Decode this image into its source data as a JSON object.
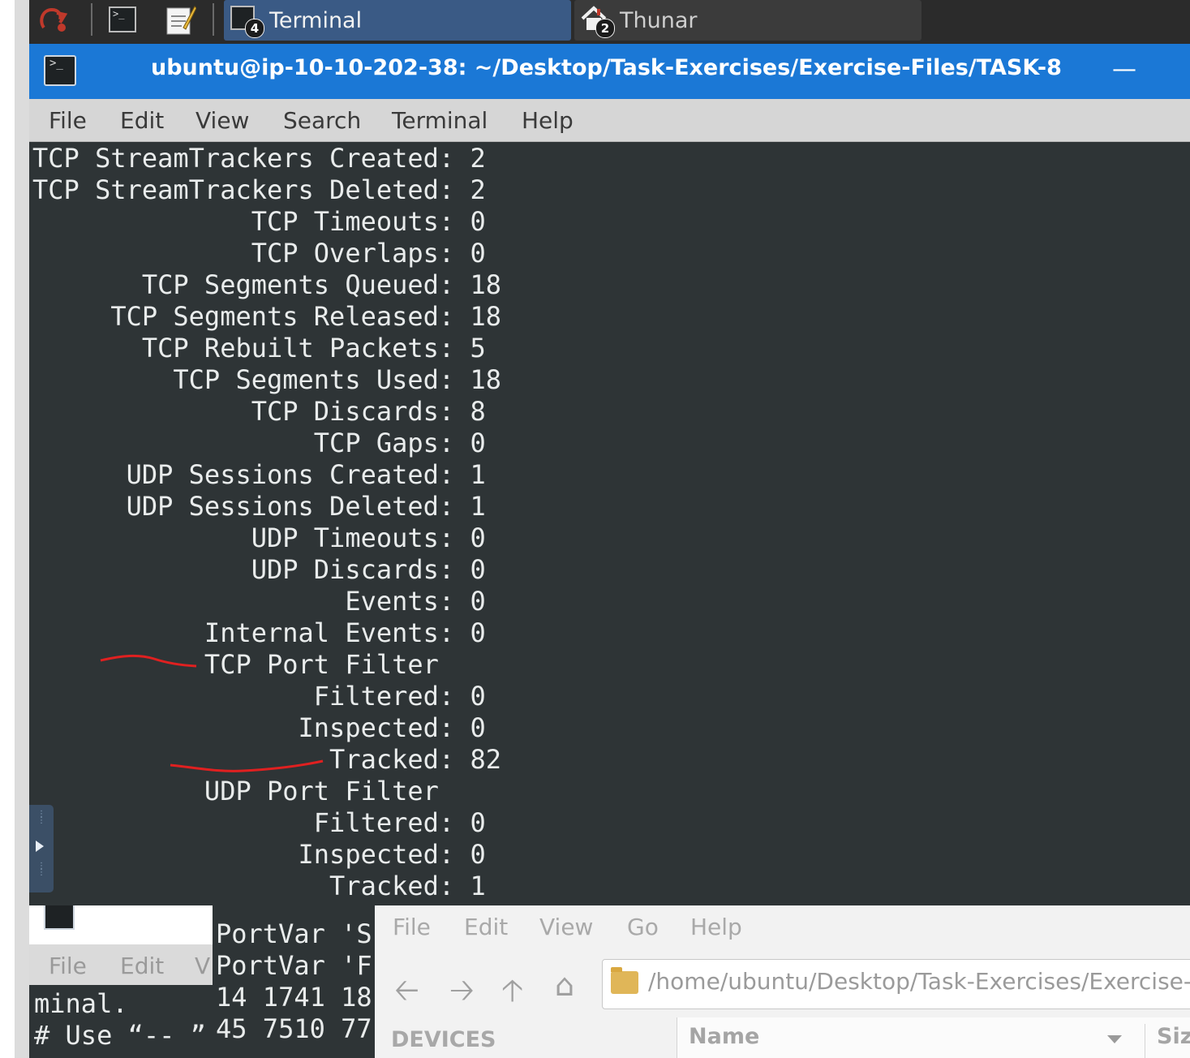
{
  "taskbar": {
    "tasks": [
      {
        "label": "Terminal",
        "badge": "4"
      },
      {
        "label": "Thunar",
        "badge": "2"
      }
    ]
  },
  "terminal": {
    "title": "ubuntu@ip-10-10-202-38: ~/Desktop/Task-Exercises/Exercise-Files/TASK-8",
    "minimize_glyph": "—",
    "menu": [
      "File",
      "Edit",
      "View",
      "Search",
      "Terminal",
      "Help"
    ],
    "lines": [
      "TCP StreamTrackers Created: 2",
      "TCP StreamTrackers Deleted: 2",
      "              TCP Timeouts: 0",
      "              TCP Overlaps: 0",
      "       TCP Segments Queued: 18",
      "     TCP Segments Released: 18",
      "       TCP Rebuilt Packets: 5",
      "         TCP Segments Used: 18",
      "              TCP Discards: 8",
      "                  TCP Gaps: 0",
      "      UDP Sessions Created: 1",
      "      UDP Sessions Deleted: 1",
      "              UDP Timeouts: 0",
      "              UDP Discards: 0",
      "                    Events: 0",
      "           Internal Events: 0",
      "           TCP Port Filter",
      "                  Filtered: 0",
      "                 Inspected: 0",
      "                   Tracked: 82",
      "           UDP Port Filter",
      "                  Filtered: 0",
      "                 Inspected: 0",
      "                   Tracked: 1"
    ]
  },
  "bottom_terminal_1": {
    "menu": [
      "File",
      "Edit",
      "V"
    ],
    "lines": [
      "minal.",
      "# Use “-- ”"
    ]
  },
  "bottom_terminal_2": {
    "lines": [
      "PortVar 'S",
      "PortVar 'F",
      "14 1741 18",
      "45 7510 77"
    ]
  },
  "thunar": {
    "menu": [
      "File",
      "Edit",
      "View",
      "Go",
      "Help"
    ],
    "path": "/home/ubuntu/Desktop/Task-Exercises/Exercise-",
    "sidebar_header": "DEVICES",
    "column_name": "Name",
    "column_size": "Siz"
  }
}
